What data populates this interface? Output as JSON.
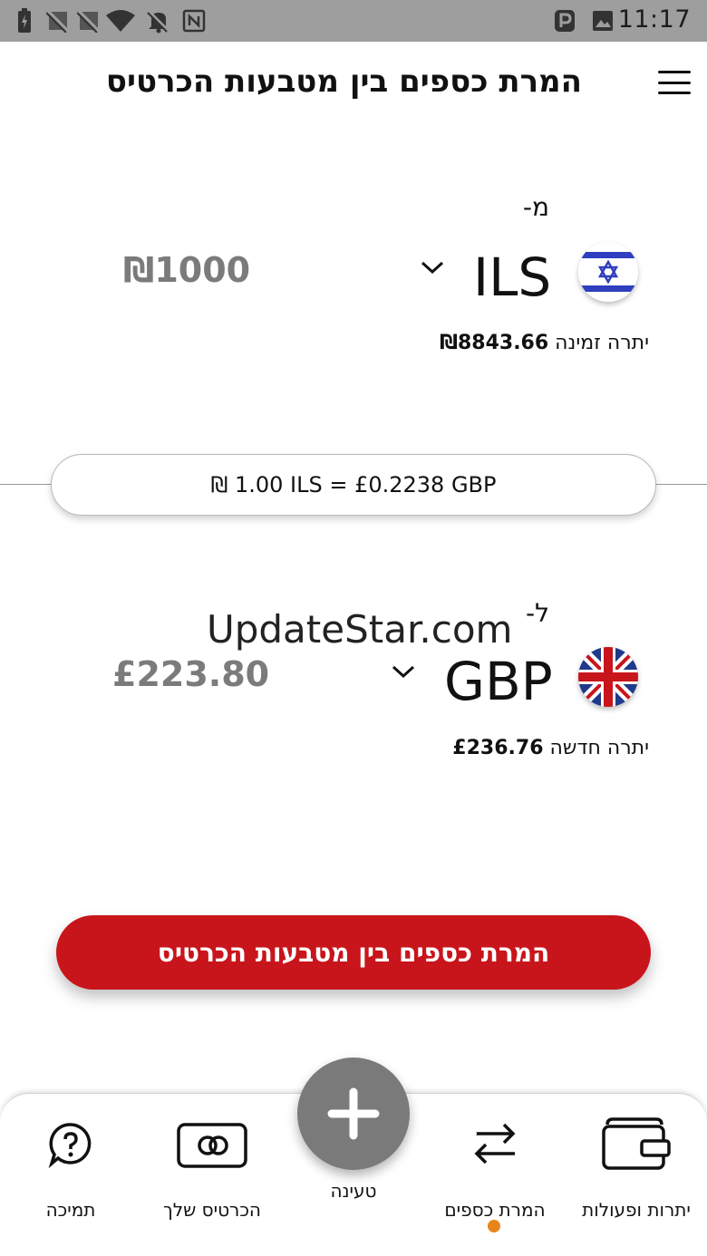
{
  "status_bar": {
    "time": "11:17",
    "left_icons": [
      "battery-icon",
      "notification-off-icon",
      "notification-off-icon",
      "wifi-icon",
      "bell-off-icon",
      "nfc-icon"
    ],
    "right_icons": [
      "parking-icon",
      "image-icon"
    ]
  },
  "header": {
    "title": "המרת כספים בין מטבעות הכרטיס",
    "menu_icon": "hamburger-menu-icon"
  },
  "from": {
    "label": "מ-",
    "currency": "ILS",
    "flag": "israel-flag-icon",
    "amount": "₪1000",
    "balance_label": "יתרה זמינה ",
    "balance_value": "₪8843.66"
  },
  "rate": {
    "text": "₪ 1.00 ILS = £0.2238 GBP"
  },
  "to": {
    "label": "ל-",
    "currency": "GBP",
    "flag": "uk-flag-icon",
    "amount": "£223.80",
    "balance_label": "יתרה חדשה ",
    "balance_value": "£236.76"
  },
  "watermark": "UpdateStar.com",
  "convert_button": {
    "label": "המרת כספים בין מטבעות הכרטיס"
  },
  "bottom_nav": {
    "items": [
      {
        "label": "תמיכה",
        "icon": "help-chat-icon"
      },
      {
        "label": "הכרטיס שלך",
        "icon": "credit-card-icon"
      },
      {
        "label": "טעינה",
        "icon": "plus-icon"
      },
      {
        "label": "המרת כספים",
        "icon": "exchange-arrows-icon",
        "active": true
      },
      {
        "label": "יתרות ופעולות",
        "icon": "wallet-icon"
      }
    ],
    "active_color": "#e8851a"
  },
  "colors": {
    "accent": "#c8151b",
    "status_bar": "#9e9e9e",
    "amount_text": "#7b7b7b"
  }
}
